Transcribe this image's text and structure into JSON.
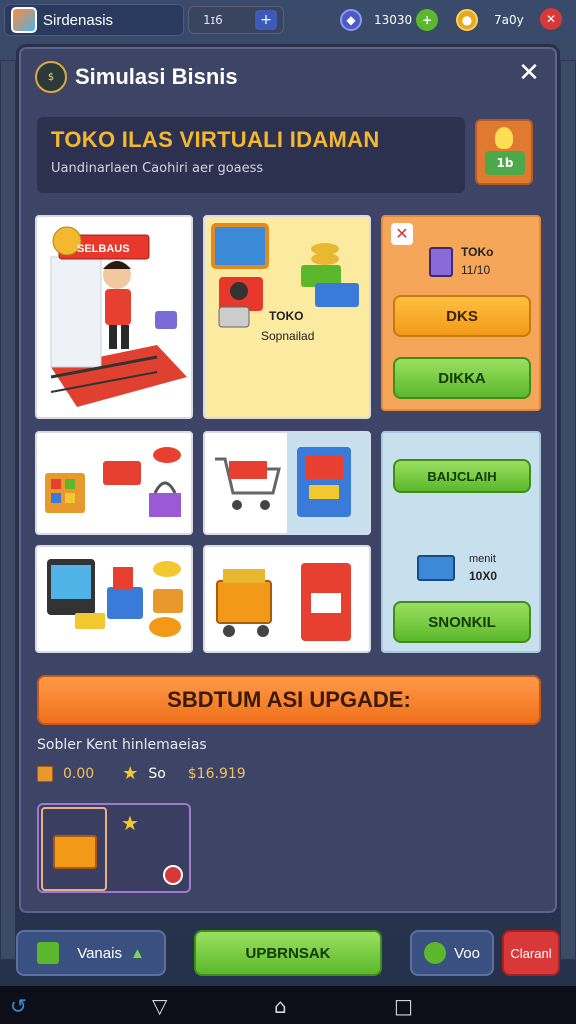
{
  "topbar": {
    "app_name": "Sirdenasis",
    "count_label": "1ɪ6",
    "plus_label": "+",
    "resources": [
      {
        "icon": "gem-icon",
        "value": "13030",
        "color": "#4a5ac8",
        "plus": "+"
      },
      {
        "icon": "coin-icon",
        "value": "7a0y",
        "color": "#e8a820"
      },
      {
        "icon": "close-icon",
        "color": "#d83838"
      }
    ]
  },
  "panel": {
    "title": "Simulasi Bisnis",
    "close_label": "✕",
    "banner": {
      "title": "TOKO ILAS VIRTUALI IDAMAN",
      "subtitle": "Uandinarlaen Caohiri aer goaess",
      "badge": "1b"
    },
    "tiles": {
      "shop_sign": "SELBAUS",
      "gadget_caption_1": "TOKO",
      "gadget_caption_2": "Sopnailad",
      "offer_name": "TOKo",
      "offer_value": "11/10",
      "offer_btn_1": "DKS",
      "offer_btn_2": "DIKKA",
      "side_btn_1": "BAIJCLAIH",
      "side_item_name": "menit",
      "side_item_value": "10X0",
      "side_btn_2": "SNONKIL"
    },
    "upgrade_label": "SBDTUM ASI UPGADE:",
    "sublabel": "Sobler Kent hinlemaeias",
    "stats": {
      "box_value": "0.00",
      "star_value": "So",
      "money_value": "$16.919"
    }
  },
  "bottom_bar": {
    "left_label": "Vanais",
    "center_label": "UPBRNSAK",
    "right_label": "Voo",
    "danger_label": "Claranl"
  },
  "colors": {
    "accent_orange": "#f0701c",
    "accent_green": "#5bb82c",
    "panel_bg": "#3e4466",
    "title_gold": "#f4b830"
  }
}
